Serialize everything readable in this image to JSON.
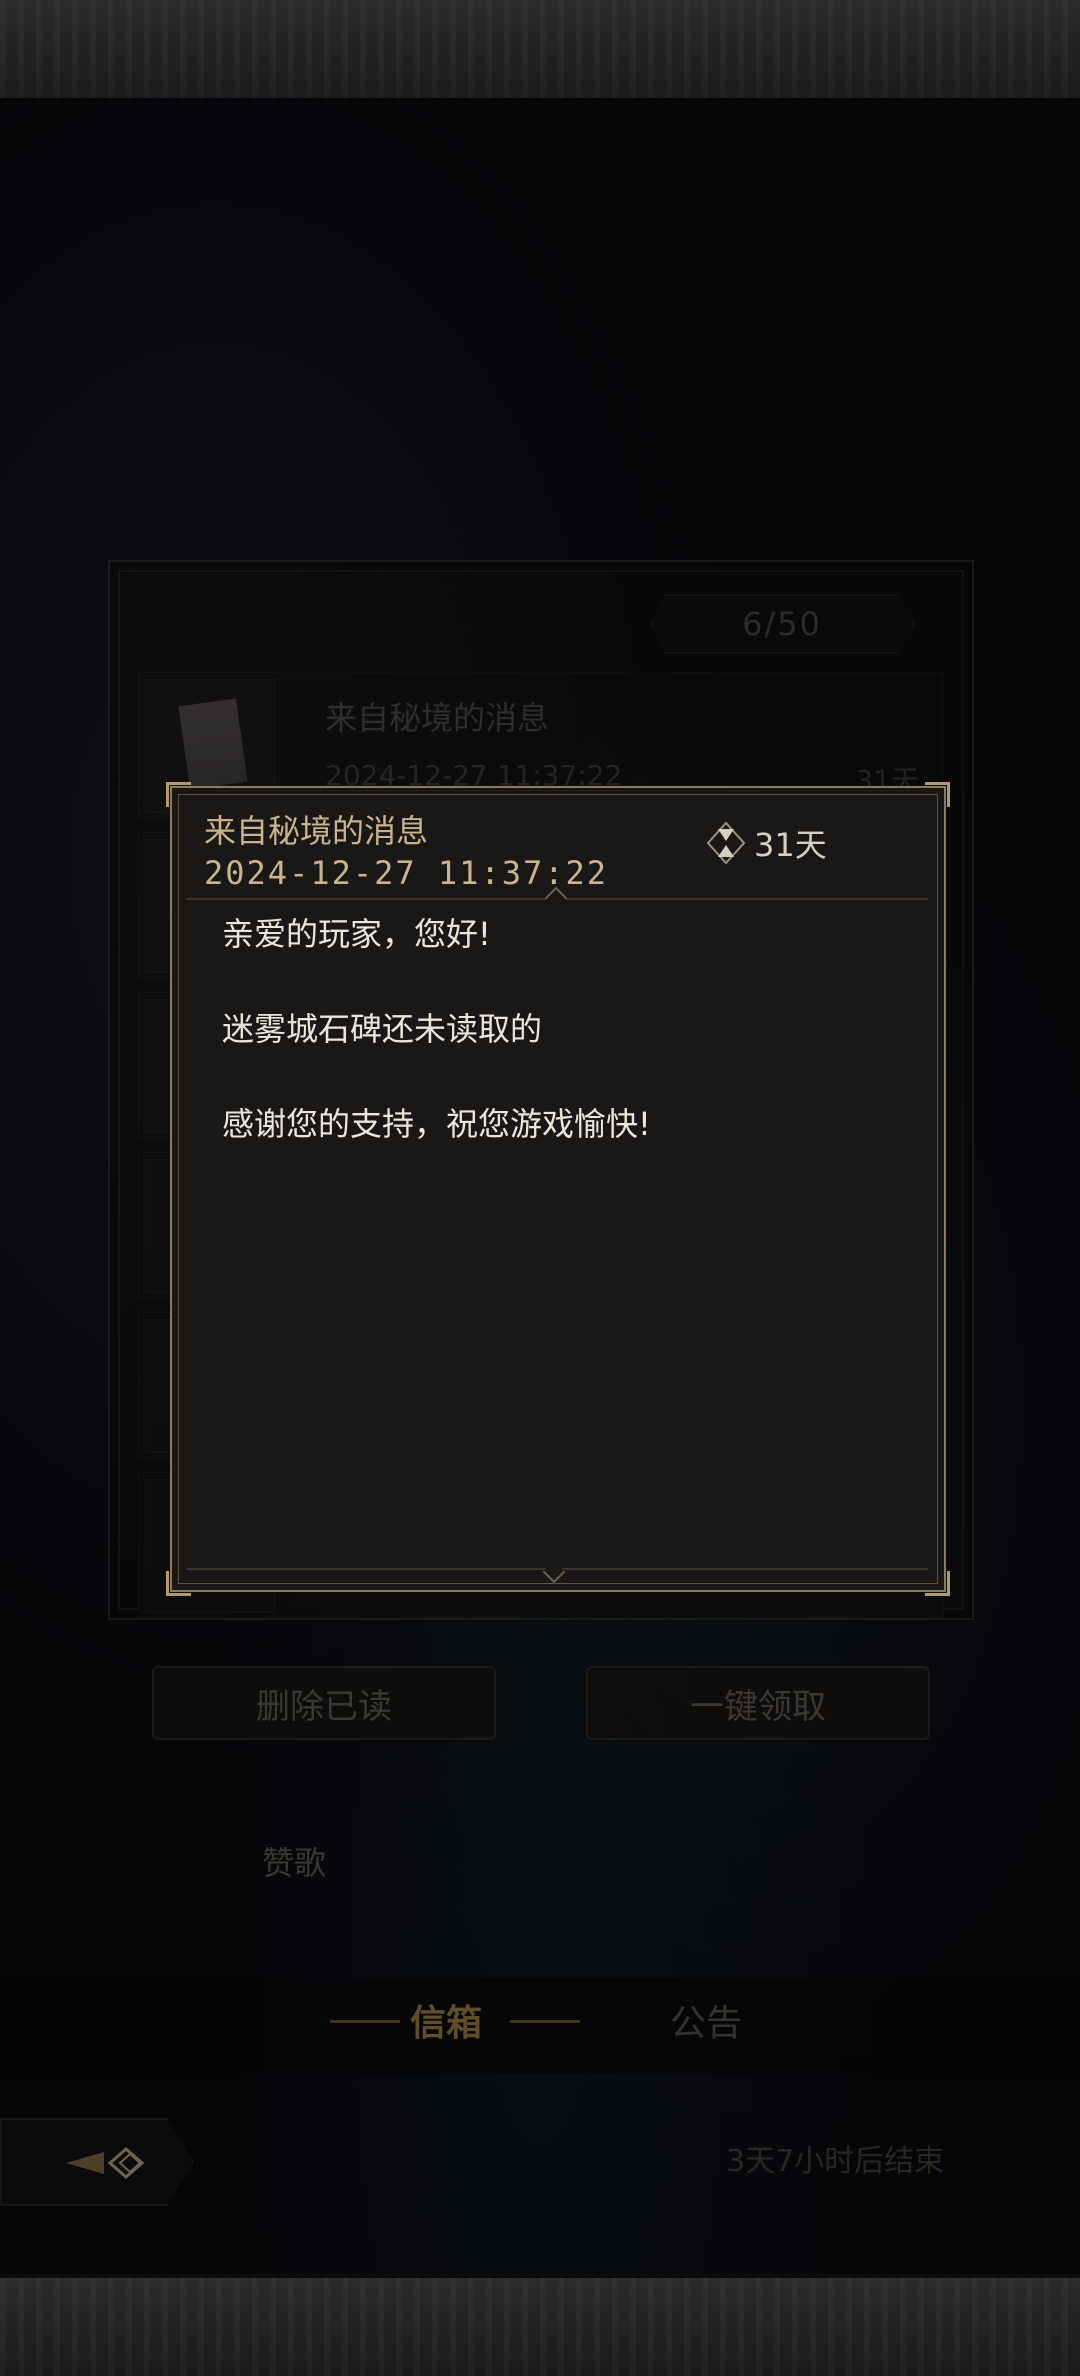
{
  "mailbox": {
    "count": "6/50",
    "items": [
      {
        "title": "来自秘境的消息",
        "date": "2024-12-27 11:37:22",
        "days": "31天"
      }
    ],
    "delete_read_label": "删除已读",
    "claim_all_label": "一键领取",
    "praise_label": "赞歌"
  },
  "tabs": {
    "mail": "信箱",
    "notice": "公告"
  },
  "footer": {
    "countdown": "3天7小时后结束"
  },
  "dialog": {
    "title": "来自秘境的消息",
    "date": "2024-12-27  11:37:22",
    "expire": "31天",
    "lines": [
      "亲爱的玩家，您好!",
      "迷雾城石碑还未读取的",
      "感谢您的支持，祝您游戏愉快!"
    ]
  },
  "colors": {
    "accent_gold": "#c9b48d",
    "tab_active": "#b08c4a",
    "dialog_bg": "#1a1816"
  },
  "icons": {
    "hourglass": "hourglass-icon",
    "back": "back-arrow-icon"
  }
}
